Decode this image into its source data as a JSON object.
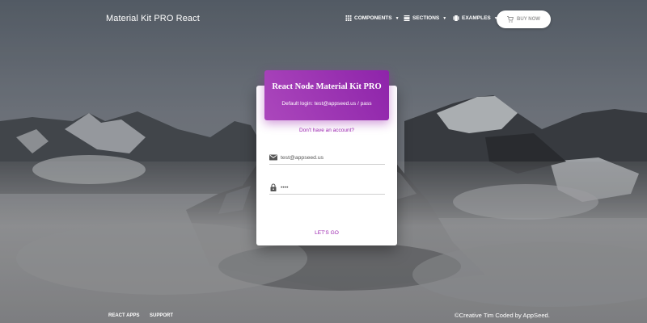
{
  "navbar": {
    "brand": "Material Kit PRO React",
    "items": [
      {
        "label": "COMPONENTS",
        "icon": "apps-grid-icon"
      },
      {
        "label": "SECTIONS",
        "icon": "view-day-icon"
      },
      {
        "label": "EXAMPLES",
        "icon": "view-carousel-icon"
      }
    ],
    "buy_button": {
      "label": "BUY NOW",
      "icon": "shopping-cart-icon"
    }
  },
  "login_card": {
    "title": "React Node Material Kit PRO",
    "subtitle": "Default login: test@appseed.us / pass",
    "signup_link": "Don't have an account?",
    "email": {
      "value": "test@appseed.us",
      "icon": "email-icon"
    },
    "password": {
      "value": "••••",
      "icon": "lock-icon"
    },
    "submit_label": "LET'S GO"
  },
  "footer": {
    "links": [
      "REACT APPS",
      "SUPPORT"
    ],
    "copyright": "©Creative Tim Coded by AppSeed."
  },
  "colors": {
    "accent": "#9c27b0",
    "header_gradient_start": "#ab47bc",
    "header_gradient_end": "#8e24aa"
  }
}
